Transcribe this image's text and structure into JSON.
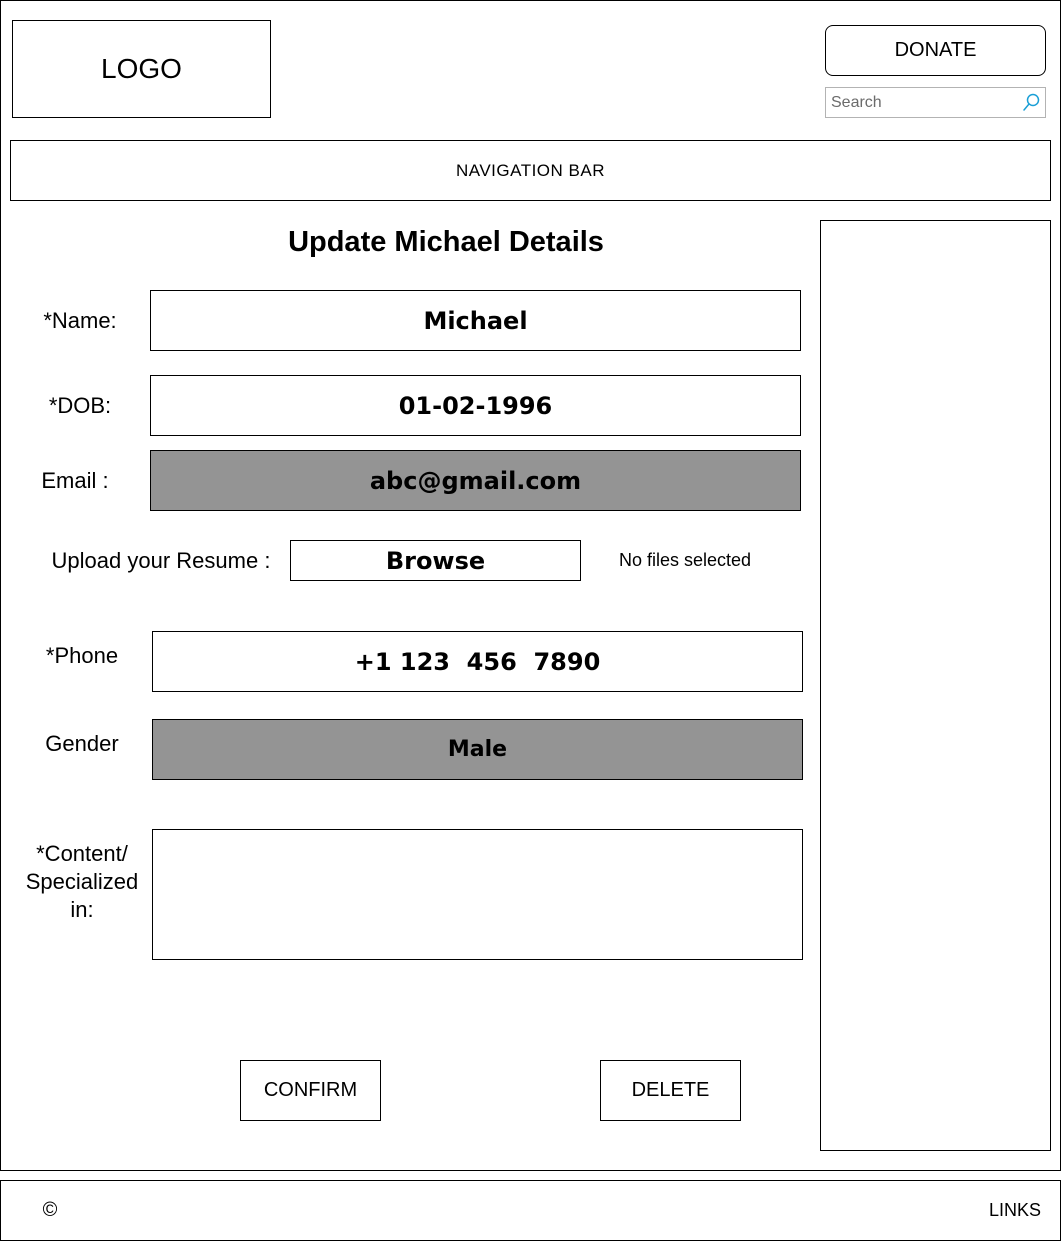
{
  "header": {
    "logo": "LOGO",
    "donate_label": "DONATE",
    "search": {
      "placeholder": "Search",
      "icon": "search-icon"
    }
  },
  "nav": {
    "label": "NAVIGATION BAR"
  },
  "form": {
    "title": "Update Michael Details",
    "name": {
      "label": "*Name:",
      "value": "Michael"
    },
    "dob": {
      "label": "*DOB:",
      "value": "01-02-1996"
    },
    "email": {
      "label": "Email :",
      "value": "abc@gmail.com"
    },
    "resume": {
      "label": "Upload your Resume :",
      "button": "Browse",
      "status": "No files selected"
    },
    "phone": {
      "label": "*Phone",
      "value": "+1 123  456  7890"
    },
    "gender": {
      "label": "Gender",
      "value": "Male"
    },
    "content": {
      "label_lines": [
        "*Content/",
        "Specialized",
        "in:"
      ],
      "value": ""
    },
    "confirm_label": "CONFIRM",
    "delete_label": "DELETE"
  },
  "footer": {
    "copyright": "©",
    "links": "LINKS"
  },
  "colors": {
    "disabled_field": "#949494",
    "search_icon": "#1a9fd6"
  }
}
